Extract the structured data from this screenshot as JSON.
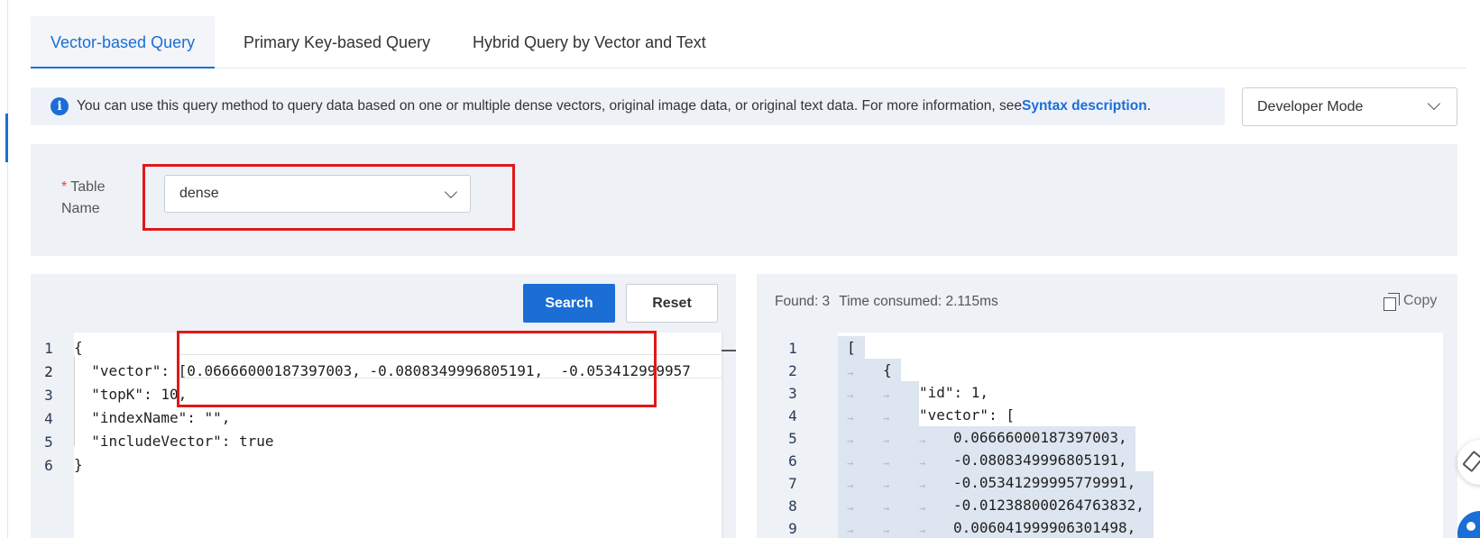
{
  "tabs": [
    {
      "label": "Vector-based Query",
      "active": true
    },
    {
      "label": "Primary Key-based Query",
      "active": false
    },
    {
      "label": "Hybrid Query by Vector and Text",
      "active": false
    }
  ],
  "info": {
    "text": "You can use this query method to query data based on one or multiple dense vectors, original image data, or original text data. For more information, see ",
    "link": "Syntax description",
    "suffix": "."
  },
  "mode_select": {
    "value": "Developer Mode"
  },
  "table_name": {
    "required_mark": "*",
    "label_line1": "Table",
    "label_line2": "Name",
    "value": "dense"
  },
  "buttons": {
    "search": "Search",
    "reset": "Reset"
  },
  "query_editor": {
    "line_numbers": [
      "1",
      "2",
      "3",
      "4",
      "5",
      "6"
    ],
    "lines": [
      "{",
      "  \"vector\": [0.06666000187397003, -0.0808349996805191,  -0.053412999957",
      "  \"topK\": 10,",
      "  \"indexName\": \"\",",
      "  \"includeVector\": true",
      "}"
    ]
  },
  "result": {
    "found": "Found: 3",
    "time": "Time consumed: 2.115ms",
    "copy": "Copy",
    "line_numbers": [
      "1",
      "2",
      "3",
      "4",
      "5",
      "6",
      "7",
      "8",
      "9"
    ],
    "lines": [
      "[",
      "{",
      "\"id\": 1,",
      "\"vector\": [",
      "0.06666000187397003,",
      "-0.0808349996805191,",
      "-0.05341299995779991,",
      "-0.012388000264763832,",
      "0.006041999906301498,"
    ]
  },
  "colors": {
    "accent": "#1a6ed6",
    "highlight_box": "#e01919",
    "panel_bg": "#eef1f6"
  },
  "icons": {
    "info": "info-circle-icon",
    "chevron": "chevron-down-icon",
    "copy": "copy-icon",
    "edit": "edit-icon"
  }
}
